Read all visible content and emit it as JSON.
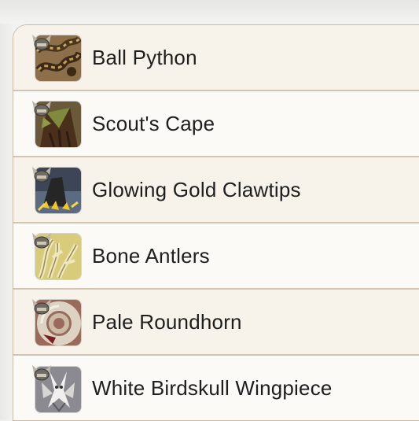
{
  "items": [
    {
      "name": "Ball Python",
      "icon": "ball-python-icon"
    },
    {
      "name": "Scout's Cape",
      "icon": "scouts-cape-icon"
    },
    {
      "name": "Glowing Gold Clawtips",
      "icon": "glowing-gold-clawtips-icon"
    },
    {
      "name": "Bone Antlers",
      "icon": "bone-antlers-icon"
    },
    {
      "name": "Pale Roundhorn",
      "icon": "pale-roundhorn-icon"
    },
    {
      "name": "White Birdskull Wingpiece",
      "icon": "white-birdskull-wingpiece-icon"
    }
  ],
  "badge_icon": "horned-helmet-icon",
  "colors": {
    "row_bg": "#fbfaf7",
    "row_alt_bg": "#f7f3ea",
    "divider": "#d3c6ad",
    "text": "#1e1e1e"
  }
}
